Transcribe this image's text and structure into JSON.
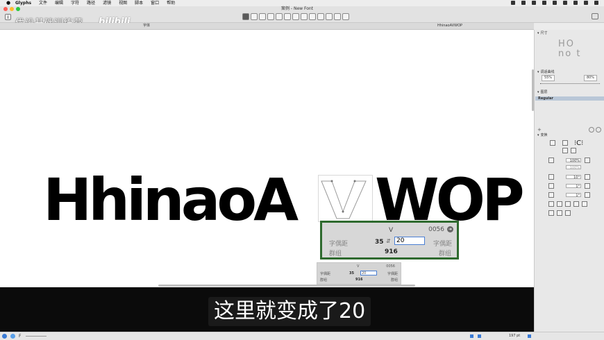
{
  "menubar": {
    "apple": "",
    "items": [
      "Glyphs",
      "文件",
      "编辑",
      "字符",
      "路径",
      "滤镜",
      "视图",
      "脚本",
      "窗口",
      "帮助"
    ]
  },
  "window": {
    "title": "案例 - New Font"
  },
  "watermark": {
    "text": "优设基础训练营",
    "logo": "bilibili"
  },
  "tabbar": {
    "left_label": "字体",
    "tab_text": "HhinaoAVWOP"
  },
  "canvas": {
    "text_left": "HhinaoA",
    "text_right": "WOP"
  },
  "kerning_popup": {
    "glyph": "V",
    "unicode": "0056",
    "left_label": "字偶距",
    "left_value": "35",
    "input_value": "20",
    "right_label": "字偶距",
    "group_label": "群组",
    "group_value": "916",
    "group_right_label": "群组"
  },
  "kerning_popup_small": {
    "glyph": "V",
    "unicode": "0056",
    "left_label": "字偶距",
    "left_value": "35",
    "input_value": "20",
    "right_label": "字偶距",
    "group_label": "群组",
    "group_value": "916",
    "group_right_label": "群组"
  },
  "subtitle": "这里就变成了20",
  "sidebar": {
    "dimensions_title": "尺寸",
    "preview_text_1": "HO",
    "preview_text_2": "no t",
    "fit_curve_title": "调适曲线",
    "fit_left": "55%",
    "fit_right": "80%",
    "layers_title": "图层",
    "layer_name": "Regular",
    "transform_title": "变换",
    "scale_1": "100%",
    "scale_2": "100%",
    "rotate": "10°",
    "slant_1": "1°",
    "slant_2": "1°"
  },
  "statusbar": {
    "icon_label": "F",
    "zoom": "197 pt"
  }
}
